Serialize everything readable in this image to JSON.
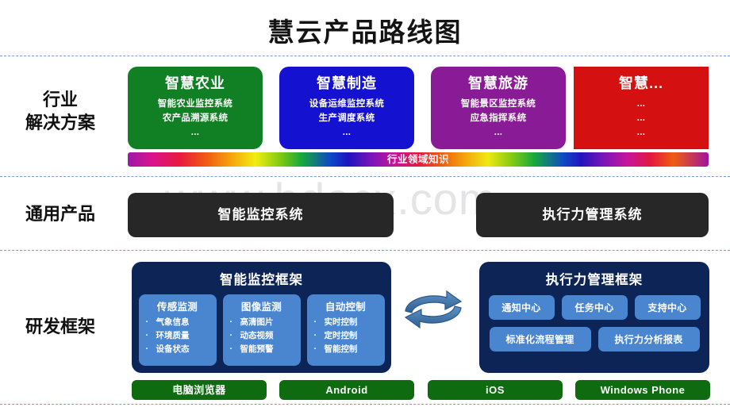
{
  "page": {
    "title": "慧云产品路线图",
    "watermark": "www.bdocx.com"
  },
  "rows": {
    "industry_label": "行业\n解决方案",
    "industry_label_line1": "行业",
    "industry_label_line2": "解决方案",
    "general_label": "通用产品",
    "framework_label": "研发框架"
  },
  "industry_cards": [
    {
      "title": "智慧农业",
      "color": "#118024",
      "items": [
        "智能农业监控系统",
        "农产品溯源系统",
        "..."
      ]
    },
    {
      "title": "智慧制造",
      "color": "#1511d0",
      "items": [
        "设备运维监控系统",
        "生产调度系统",
        "..."
      ]
    },
    {
      "title": "智慧旅游",
      "color": "#8a1b96",
      "items": [
        "智能景区监控系统",
        "应急指挥系统",
        "..."
      ]
    },
    {
      "title": "智慧...",
      "color": "#d41010",
      "items": [
        "...",
        "...",
        "..."
      ]
    }
  ],
  "knowledge_bar": {
    "label": "行业领域知识"
  },
  "general_products": [
    {
      "label": "智能监控系统"
    },
    {
      "label": "执行力管理系统"
    }
  ],
  "frameworks": {
    "left": {
      "title": "智能监控框架",
      "groups": [
        {
          "title": "传感监测",
          "items": [
            "气象信息",
            "环境质量",
            "设备状态"
          ]
        },
        {
          "title": "图像监测",
          "items": [
            "高清图片",
            "动态视频",
            "智能预警"
          ]
        },
        {
          "title": "自动控制",
          "items": [
            "实时控制",
            "定时控制",
            "智能控制"
          ]
        }
      ]
    },
    "right": {
      "title": "执行力管理框架",
      "row1": [
        "通知中心",
        "任务中心",
        "支持中心"
      ],
      "row2": [
        "标准化流程管理",
        "执行力分析报表"
      ]
    },
    "bullet": "·"
  },
  "platforms": [
    {
      "label": "电脑浏览器"
    },
    {
      "label": "Android"
    },
    {
      "label": "iOS"
    },
    {
      "label": "Windows Phone"
    }
  ],
  "colors": {
    "dark_card": "#272727",
    "framework_panel": "#0d2457",
    "sub_card": "#4a85d0",
    "platform_green": "#0f6b10",
    "divider": "#7a9ad4",
    "arrow_blue": "#3a6fa8"
  }
}
